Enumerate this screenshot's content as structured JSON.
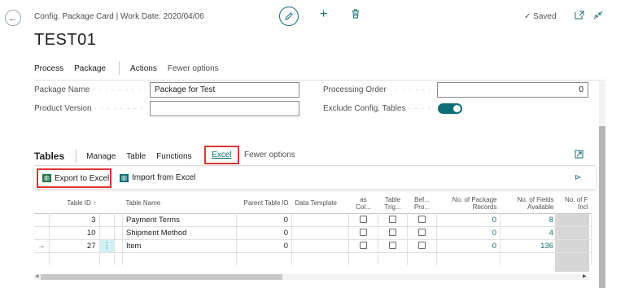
{
  "header": {
    "breadcrumb": "Config. Package Card | Work Date: 2020/04/06",
    "title": "TEST01",
    "saved_label": "Saved"
  },
  "action_bar": {
    "items": [
      "Process",
      "Package",
      "Actions",
      "Fewer options"
    ]
  },
  "fields": {
    "package_name_label": "Package Name",
    "package_name_value": "Package for Test",
    "product_version_label": "Product Version",
    "product_version_value": "",
    "processing_order_label": "Processing Order",
    "processing_order_value": "0",
    "exclude_config_label": "Exclude Config. Tables",
    "exclude_config_on": true
  },
  "tables_part": {
    "title": "Tables",
    "tabs": [
      "Manage",
      "Table",
      "Functions",
      "Excel",
      "Fewer options"
    ],
    "active_tab": "Excel",
    "export_label": "Export to Excel",
    "import_label": "Import from Excel"
  },
  "grid": {
    "columns": [
      "Table ID ↑",
      "Table Name",
      "Parent Table ID",
      "Data Template",
      "as Col...",
      "Table Trig...",
      "Bef... Pro...",
      "No. of Package Records",
      "No. of Fields Available",
      "No. of F Incl"
    ],
    "rows": [
      {
        "table_id": "3",
        "table_name": "Payment Terms",
        "parent_id": "0",
        "data_template": "",
        "records": "0",
        "fields_available": "8",
        "current": false
      },
      {
        "table_id": "10",
        "table_name": "Shipment Method",
        "parent_id": "0",
        "data_template": "",
        "records": "0",
        "fields_available": "4",
        "current": false
      },
      {
        "table_id": "27",
        "table_name": "Item",
        "parent_id": "0",
        "data_template": "",
        "records": "0",
        "fields_available": "136",
        "current": true
      }
    ]
  },
  "colors": {
    "accent": "#0f6d76",
    "highlight_border": "#e03434",
    "excel_green": "#1e7145"
  }
}
